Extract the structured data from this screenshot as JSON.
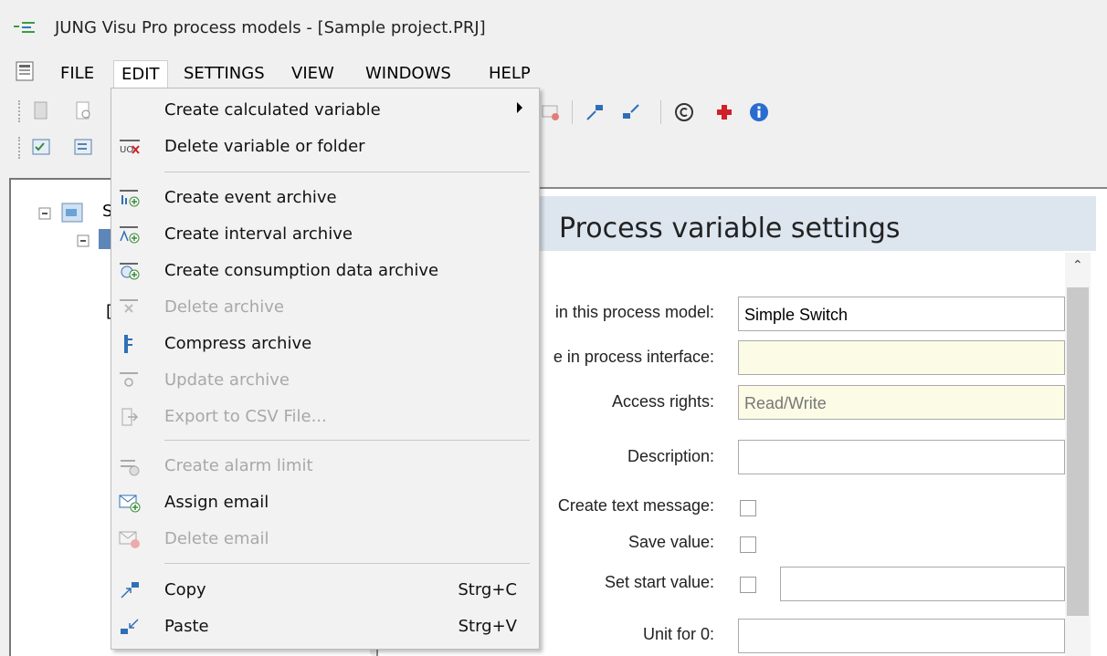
{
  "window": {
    "title": "JUNG Visu Pro process models - [Sample project.PRJ]"
  },
  "menubar": {
    "items": [
      {
        "label": "FILE"
      },
      {
        "label": "EDIT"
      },
      {
        "label": "SETTINGS"
      },
      {
        "label": "VIEW"
      },
      {
        "label": "WINDOWS"
      },
      {
        "label": "HELP"
      }
    ]
  },
  "edit_menu": {
    "items": [
      {
        "label": "Create calculated variable",
        "icon": "none",
        "enabled": true,
        "submenu": true
      },
      {
        "label": "Delete variable or folder",
        "icon": "delete-variable-icon",
        "enabled": true
      },
      {
        "label": "Create event archive",
        "icon": "event-archive-icon",
        "enabled": true
      },
      {
        "label": "Create interval archive",
        "icon": "interval-archive-icon",
        "enabled": true
      },
      {
        "label": "Create consumption data archive",
        "icon": "consumption-archive-icon",
        "enabled": true
      },
      {
        "label": "Delete archive",
        "icon": "delete-archive-icon",
        "enabled": false
      },
      {
        "label": "Compress archive",
        "icon": "compress-archive-icon",
        "enabled": true
      },
      {
        "label": "Update archive",
        "icon": "update-archive-icon",
        "enabled": false
      },
      {
        "label": "Export to CSV File...",
        "icon": "export-csv-icon",
        "enabled": false
      },
      {
        "label": "Create alarm limit",
        "icon": "alarm-limit-icon",
        "enabled": false
      },
      {
        "label": "Assign email",
        "icon": "assign-email-icon",
        "enabled": true
      },
      {
        "label": "Delete email",
        "icon": "delete-email-icon",
        "enabled": false
      },
      {
        "label": "Copy",
        "icon": "copy-icon",
        "enabled": true,
        "shortcut": "Strg+C"
      },
      {
        "label": "Paste",
        "icon": "paste-icon",
        "enabled": true,
        "shortcut": "Strg+V"
      }
    ]
  },
  "tree": {
    "root_label_fragment": "S",
    "child_fragment": "["
  },
  "settings_panel": {
    "title": "Process variable settings",
    "fields": {
      "name_label": "in this process model:",
      "name_value": "Simple Switch",
      "interface_label": "e in process interface:",
      "interface_value": "",
      "access_label": "Access rights:",
      "access_value": "Read/Write",
      "description_label": "Description:",
      "description_value": "",
      "text_message_label": "Create text message:",
      "save_value_label": "Save value:",
      "start_value_label": "Set start value:",
      "start_value": "",
      "unit0_label": "Unit for 0:",
      "unit0_value": ""
    }
  },
  "colors": {
    "header_bg": "#dde6ef",
    "field_yellow": "#fbfbe6",
    "toolbar_red_cross": "#d0202a",
    "info_blue": "#2a6bd1"
  }
}
